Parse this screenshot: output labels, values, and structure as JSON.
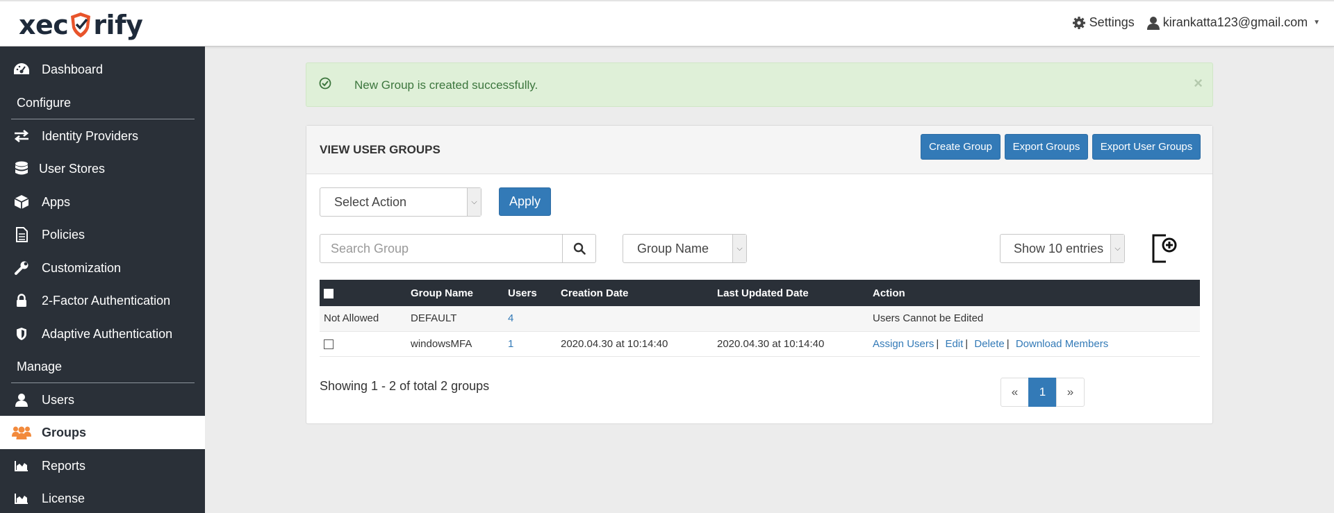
{
  "header": {
    "logo_left": "xec",
    "logo_right": "rify",
    "settings_label": "Settings",
    "user_email": "kirankatta123@gmail.com"
  },
  "sidebar": {
    "items": [
      {
        "label": "Dashboard",
        "icon": "dashboard-icon"
      },
      {
        "label": "Identity Providers",
        "icon": "exchange-icon"
      },
      {
        "label": "User Stores",
        "icon": "database-icon"
      },
      {
        "label": "Apps",
        "icon": "cube-icon"
      },
      {
        "label": "Policies",
        "icon": "document-icon"
      },
      {
        "label": "Customization",
        "icon": "wrench-icon"
      },
      {
        "label": "2-Factor Authentication",
        "icon": "lock-icon"
      },
      {
        "label": "Adaptive Authentication",
        "icon": "shield-icon"
      },
      {
        "label": "Users",
        "icon": "user-icon"
      },
      {
        "label": "Groups",
        "icon": "users-icon",
        "active": true
      },
      {
        "label": "Reports",
        "icon": "area-chart-icon"
      },
      {
        "label": "License",
        "icon": "area-chart-icon"
      }
    ],
    "sections": {
      "configure": "Configure",
      "manage": "Manage"
    }
  },
  "alert": {
    "message": "New Group is created successfully.",
    "close": "×"
  },
  "panel": {
    "title": "VIEW USER GROUPS",
    "buttons": {
      "create": "Create Group",
      "export_groups": "Export Groups",
      "export_user_groups": "Export User Groups"
    },
    "select_action": "Select Action",
    "apply": "Apply",
    "search_placeholder": "Search Group",
    "filter_select": "Group Name",
    "entries_select": "Show 10 entries"
  },
  "table": {
    "headers": [
      "Group Name",
      "Users",
      "Creation Date",
      "Last Updated Date",
      "Action"
    ],
    "rows": [
      {
        "check": "Not Allowed",
        "name": "DEFAULT",
        "users": "4",
        "created": "",
        "updated": "",
        "action": "Users Cannot be Edited"
      },
      {
        "check": "",
        "name": "windowsMFA",
        "users": "1",
        "created": "2020.04.30 at 10:14:40",
        "updated": "2020.04.30 at 10:14:40"
      }
    ],
    "actions": {
      "assign": "Assign Users",
      "edit": "Edit",
      "delete": "Delete",
      "download": "Download Members",
      "sep": "|"
    }
  },
  "footer": {
    "showing": "Showing 1 - 2 of total 2 groups",
    "pager_prev": "«",
    "pager_current": "1",
    "pager_next": "»"
  },
  "colors": {
    "sidebar_bg": "#2a3038",
    "primary": "#337ab7",
    "success_bg": "#dff0d8",
    "success_text": "#3c763d",
    "logo_accent": "#e8542b"
  }
}
